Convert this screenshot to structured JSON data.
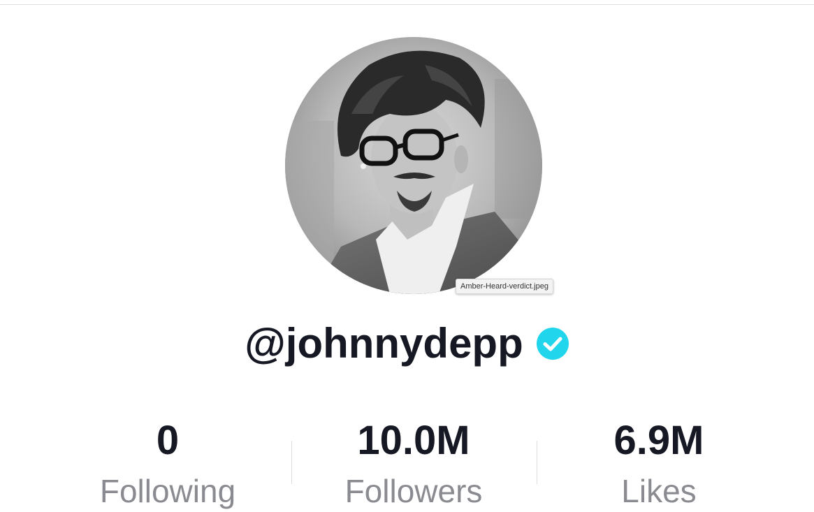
{
  "profile": {
    "username": "@johnnydepp",
    "verified": true,
    "avatar_tooltip": "Amber-Heard-verdict.jpeg",
    "verified_color": "#20d5ec"
  },
  "stats": {
    "following": {
      "value": "0",
      "label": "Following"
    },
    "followers": {
      "value": "10.0M",
      "label": "Followers"
    },
    "likes": {
      "value": "6.9M",
      "label": "Likes"
    }
  },
  "colors": {
    "text_primary": "#161823",
    "text_secondary": "#8a8b91"
  }
}
